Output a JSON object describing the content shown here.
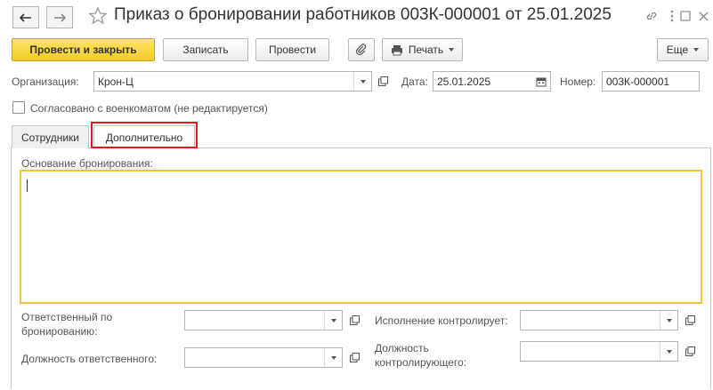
{
  "window": {
    "title": "Приказ о бронировании работников 003К-000001 от 25.01.2025",
    "back_icon": "arrow-left-icon",
    "forward_icon": "arrow-right-icon",
    "favorite_icon": "star-icon",
    "link_icon": "link-icon",
    "menu_icon": "more-vertical-icon",
    "maximize_icon": "maximize-icon",
    "close_icon": "close-icon"
  },
  "toolbar": {
    "post_close_label": "Провести и закрыть",
    "save_label": "Записать",
    "post_label": "Провести",
    "attach_icon": "paperclip-icon",
    "print_label": "Печать",
    "more_label": "Еще"
  },
  "header": {
    "org_label": "Организация:",
    "org_value": "Крон-Ц",
    "date_label": "Дата:",
    "date_value": "25.01.2025",
    "number_label": "Номер:",
    "number_value": "003К-000001",
    "agreed_label": "Согласовано с военкоматом (не редактируется)"
  },
  "tabs": [
    {
      "label": "Сотрудники",
      "active": false
    },
    {
      "label": "Дополнительно",
      "active": true
    }
  ],
  "additional": {
    "basis_label": "Основание бронирования:",
    "basis_value": "",
    "responsible_label_1": "Ответственный по",
    "responsible_label_2": "бронированию:",
    "responsible_value": "",
    "responsible_position_label": "Должность ответственного:",
    "responsible_position_value": "",
    "controller_label": "Исполнение контролирует:",
    "controller_value": "",
    "controller_position_label_1": "Должность",
    "controller_position_label_2": "контролирующего:",
    "controller_position_value": ""
  },
  "colors": {
    "primary_button": "#f3cb2a",
    "focus_border": "#f2c53b",
    "tab_highlight": "#e01b1b"
  }
}
